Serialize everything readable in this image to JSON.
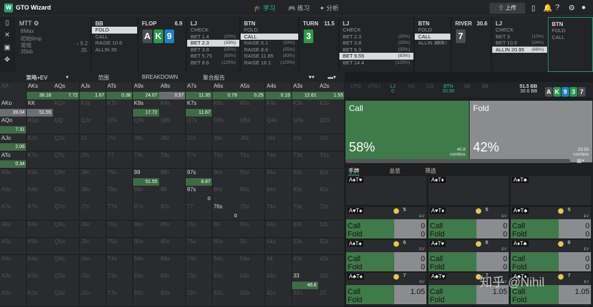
{
  "app": {
    "title": "GTO Wizard",
    "tabs": [
      "学习",
      "练习",
      "分析"
    ],
    "upload": "上传"
  },
  "mtt": {
    "title": "MTT",
    "lines": [
      "8Max",
      "初始limp",
      "常规",
      "35bb"
    ],
    "side": [
      "9.2",
      "35"
    ]
  },
  "colors": {
    "accent": "#1e9e6c",
    "call": "#3f7a4a",
    "fold": "#8a8c90"
  },
  "columns": [
    {
      "hd": "BB",
      "acts": [
        [
          "FOLD",
          ""
        ],
        [
          "CALL",
          ""
        ],
        [
          "RAISE 10.6",
          ""
        ],
        [
          "ALLIN 35",
          ""
        ]
      ],
      "sel": 0
    },
    {
      "hd": "FLOP",
      "sub": "6.9",
      "cards": [
        [
          "A",
          "s"
        ],
        [
          "K",
          "c"
        ],
        [
          "9",
          "d"
        ]
      ]
    },
    {
      "hd": "LJ",
      "acts": [
        [
          "CHECK",
          ""
        ],
        [
          "BET 1.4",
          "(20%)"
        ],
        [
          "BET 2.3",
          "(33%)"
        ],
        [
          "BET 3.8",
          "(55%)"
        ],
        [
          "BET 5.75",
          "(83%)"
        ],
        [
          "BET 8.6",
          "(125%)"
        ]
      ],
      "sel": 2
    },
    {
      "hd": "BTN",
      "acts": [
        [
          "FOLD",
          ""
        ],
        [
          "CALL",
          ""
        ],
        [
          "RAISE 6.1",
          "(33%)"
        ],
        [
          "RAISE 8.6",
          "(55%)"
        ],
        [
          "RAISE 11.85",
          "(83%)"
        ],
        [
          "RAISE 16.1",
          "(125%)"
        ]
      ],
      "sel": 1
    },
    {
      "hd": "TURN",
      "sub": "11.5",
      "cards": [
        [
          "3",
          "c"
        ]
      ]
    },
    {
      "hd": "LJ",
      "acts": [
        [
          "CHECK",
          ""
        ],
        [
          "BET 2.3",
          "(20%)"
        ],
        [
          "BET 3.8",
          "(33%)"
        ],
        [
          "BET 6.3",
          "(55%)"
        ],
        [
          "BET 9.55",
          "(83%)"
        ],
        [
          "BET 14.4",
          "(125%)"
        ]
      ],
      "sel": 4
    },
    {
      "hd": "BTN",
      "acts": [
        [
          "FOLD",
          ""
        ],
        [
          "CALL",
          ""
        ],
        [
          "ALLIN 30.5",
          "(66%)"
        ]
      ],
      "sel": 1
    },
    {
      "hd": "RIVER",
      "sub": "30.6",
      "cards": [
        [
          "7",
          "s"
        ]
      ]
    },
    {
      "hd": "LJ",
      "acts": [
        [
          "CHECK",
          ""
        ],
        [
          "BET 3",
          "(10%)"
        ],
        [
          "BET 10.5",
          "(34%)"
        ],
        [
          "ALLIN 20.95",
          "(68%)"
        ]
      ],
      "sel": 3
    },
    {
      "hd": "BTN",
      "acts": [
        [
          "FOLD",
          ""
        ],
        [
          "CALL",
          ""
        ]
      ],
      "sel": -1
    }
  ],
  "subtabs": [
    "策略+EV",
    "范围",
    "BREAKDOWN",
    "聚合报告"
  ],
  "grid": [
    [
      [
        "AA",
        "",
        ""
      ],
      [
        "AKs",
        "38.18",
        "g"
      ],
      [
        "AQs",
        "7.72",
        "g"
      ],
      [
        "AJs",
        "1.67",
        "g"
      ],
      [
        "ATs",
        "0.38",
        "g"
      ],
      [
        "A9s",
        "24.07",
        "g"
      ],
      [
        "A8s",
        "0.57",
        "gr"
      ],
      [
        "A7s",
        "11.35",
        "g"
      ],
      [
        "A6s",
        "0.79",
        "g"
      ],
      [
        "A5s",
        "0.25",
        "g"
      ],
      [
        "A4s",
        "0.19",
        "g"
      ],
      [
        "A3s",
        "12.61",
        "g"
      ],
      [
        "A2s",
        "1.55",
        "g"
      ]
    ],
    [
      [
        "AKo",
        "39.04",
        "gr"
      ],
      [
        "KK",
        "51.55",
        "gr"
      ],
      [
        "KQs",
        "",
        ""
      ],
      [
        "KJs",
        "",
        ""
      ],
      [
        "KTs",
        "",
        ""
      ],
      [
        "K9s",
        "17.72",
        "g"
      ],
      [
        "K8s",
        "",
        ""
      ],
      [
        "K7s",
        "11.67",
        "g"
      ],
      [
        "K6s",
        "",
        ""
      ],
      [
        "K5s",
        "",
        ""
      ],
      [
        "K4s",
        "",
        ""
      ],
      [
        "K3s",
        "",
        ""
      ],
      [
        "K2s",
        "",
        ""
      ]
    ],
    [
      [
        "AQo",
        "7.31",
        "g"
      ],
      [
        "KQo",
        "",
        ""
      ],
      [
        "QQ",
        "",
        ""
      ],
      [
        "QJs",
        "",
        ""
      ],
      [
        "QTs",
        "",
        ""
      ],
      [
        "Q9s",
        "",
        ""
      ],
      [
        "Q8s",
        "",
        ""
      ],
      [
        "Q7s",
        "",
        ""
      ],
      [
        "Q6s",
        "",
        ""
      ],
      [
        "Q5s",
        "",
        ""
      ],
      [
        "Q4s",
        "",
        ""
      ],
      [
        "Q3s",
        "",
        ""
      ],
      [
        "Q2s",
        "",
        ""
      ]
    ],
    [
      [
        "AJo",
        "2.06",
        "g"
      ],
      [
        "KJo",
        "",
        ""
      ],
      [
        "QJo",
        "",
        ""
      ],
      [
        "JJ",
        "",
        ""
      ],
      [
        "JTs",
        "",
        ""
      ],
      [
        "J9s",
        "",
        ""
      ],
      [
        "J8s",
        "",
        ""
      ],
      [
        "J7s",
        "",
        ""
      ],
      [
        "J6s",
        "",
        ""
      ],
      [
        "J5s",
        "",
        ""
      ],
      [
        "J4s",
        "",
        ""
      ],
      [
        "J3s",
        "",
        ""
      ],
      [
        "J2s",
        "",
        ""
      ]
    ],
    [
      [
        "ATo",
        "0.34",
        "g"
      ],
      [
        "KTo",
        "",
        ""
      ],
      [
        "QTo",
        "",
        ""
      ],
      [
        "JTo",
        "",
        ""
      ],
      [
        "TT",
        "",
        ""
      ],
      [
        "T9s",
        "",
        ""
      ],
      [
        "T8s",
        "",
        ""
      ],
      [
        "T7s",
        "",
        ""
      ],
      [
        "T6s",
        "",
        ""
      ],
      [
        "T5s",
        "",
        ""
      ],
      [
        "T4s",
        "",
        ""
      ],
      [
        "T3s",
        "",
        ""
      ],
      [
        "T2s",
        "",
        ""
      ]
    ],
    [
      [
        "A9o",
        "",
        ""
      ],
      [
        "K9o",
        "",
        ""
      ],
      [
        "Q9o",
        "",
        ""
      ],
      [
        "J9o",
        "",
        ""
      ],
      [
        "T9o",
        "",
        ""
      ],
      [
        "99",
        "51.55",
        "g"
      ],
      [
        "98s",
        "",
        ""
      ],
      [
        "97s",
        "8.87",
        "g"
      ],
      [
        "96s",
        "",
        ""
      ],
      [
        "95s",
        "",
        ""
      ],
      [
        "94s",
        "",
        ""
      ],
      [
        "93s",
        "",
        ""
      ],
      [
        "92s",
        "",
        ""
      ]
    ],
    [
      [
        "A8o",
        "",
        ""
      ],
      [
        "K8o",
        "",
        ""
      ],
      [
        "Q8o",
        "",
        ""
      ],
      [
        "J8o",
        "",
        ""
      ],
      [
        "T8o",
        "",
        ""
      ],
      [
        "98o",
        "",
        ""
      ],
      [
        "88",
        "",
        ""
      ],
      [
        "87s",
        "0",
        ""
      ],
      [
        "86s",
        "",
        ""
      ],
      [
        "85s",
        "",
        ""
      ],
      [
        "84s",
        "",
        ""
      ],
      [
        "83s",
        "",
        ""
      ],
      [
        "82s",
        "",
        ""
      ]
    ],
    [
      [
        "A7o",
        "",
        ""
      ],
      [
        "K7o",
        "",
        ""
      ],
      [
        "Q7o",
        "",
        ""
      ],
      [
        "J7o",
        "",
        ""
      ],
      [
        "T7o",
        "",
        ""
      ],
      [
        "97o",
        "",
        ""
      ],
      [
        "87o",
        "",
        ""
      ],
      [
        "77",
        "",
        ""
      ],
      [
        "76s",
        "0",
        ""
      ],
      [
        "75s",
        "",
        ""
      ],
      [
        "74s",
        "",
        ""
      ],
      [
        "73s",
        "",
        ""
      ],
      [
        "72s",
        "",
        ""
      ]
    ],
    [
      [
        "A6o",
        "",
        ""
      ],
      [
        "K6o",
        "",
        ""
      ],
      [
        "Q6o",
        "",
        ""
      ],
      [
        "J6o",
        "",
        ""
      ],
      [
        "T6o",
        "",
        ""
      ],
      [
        "96o",
        "",
        ""
      ],
      [
        "86o",
        "",
        ""
      ],
      [
        "76o",
        "",
        ""
      ],
      [
        "66",
        "",
        ""
      ],
      [
        "65s",
        "",
        ""
      ],
      [
        "64s",
        "",
        ""
      ],
      [
        "63s",
        "",
        ""
      ],
      [
        "62s",
        "",
        ""
      ]
    ],
    [
      [
        "A5o",
        "",
        ""
      ],
      [
        "K5o",
        "",
        ""
      ],
      [
        "Q5o",
        "",
        ""
      ],
      [
        "J5o",
        "",
        ""
      ],
      [
        "T5o",
        "",
        ""
      ],
      [
        "95o",
        "",
        ""
      ],
      [
        "85o",
        "",
        ""
      ],
      [
        "75o",
        "",
        ""
      ],
      [
        "65o",
        "",
        ""
      ],
      [
        "55",
        "",
        ""
      ],
      [
        "54s",
        "",
        ""
      ],
      [
        "53s",
        "",
        ""
      ],
      [
        "52s",
        "",
        ""
      ]
    ],
    [
      [
        "A4o",
        "",
        ""
      ],
      [
        "K4o",
        "",
        ""
      ],
      [
        "Q4o",
        "",
        ""
      ],
      [
        "J4o",
        "",
        ""
      ],
      [
        "T4o",
        "",
        ""
      ],
      [
        "94o",
        "",
        ""
      ],
      [
        "84o",
        "",
        ""
      ],
      [
        "74o",
        "",
        ""
      ],
      [
        "64o",
        "",
        ""
      ],
      [
        "54o",
        "",
        ""
      ],
      [
        "44",
        "",
        ""
      ],
      [
        "43s",
        "",
        ""
      ],
      [
        "42s",
        "",
        ""
      ]
    ],
    [
      [
        "A3o",
        "",
        ""
      ],
      [
        "K3o",
        "",
        ""
      ],
      [
        "Q3o",
        "",
        ""
      ],
      [
        "J3o",
        "",
        ""
      ],
      [
        "T3o",
        "",
        ""
      ],
      [
        "93o",
        "",
        ""
      ],
      [
        "83o",
        "",
        ""
      ],
      [
        "73o",
        "",
        ""
      ],
      [
        "63o",
        "",
        ""
      ],
      [
        "53o",
        "",
        ""
      ],
      [
        "43o",
        "",
        ""
      ],
      [
        "33",
        "46.6",
        "g"
      ],
      [
        "32s",
        "",
        ""
      ]
    ],
    [
      [
        "A2o",
        "",
        ""
      ],
      [
        "K2o",
        "",
        ""
      ],
      [
        "Q2o",
        "",
        ""
      ],
      [
        "J2o",
        "",
        ""
      ],
      [
        "T2o",
        "",
        ""
      ],
      [
        "92o",
        "",
        ""
      ],
      [
        "82o",
        "",
        ""
      ],
      [
        "72o",
        "",
        ""
      ],
      [
        "62o",
        "",
        ""
      ],
      [
        "52o",
        "",
        ""
      ],
      [
        "42o",
        "",
        ""
      ],
      [
        "32o",
        "",
        ""
      ],
      [
        "22",
        "",
        ""
      ]
    ]
  ],
  "seats": [
    "UTG",
    "UTG1",
    "LJ",
    "HJ",
    "CO",
    "BTN",
    "SB",
    "BB"
  ],
  "seat_sub": [
    "",
    "",
    "0",
    "",
    "",
    "20.95",
    "",
    ""
  ],
  "stack": {
    "top": "51.5 BB",
    "bot": "30.6 BB"
  },
  "board": [
    [
      "A",
      "s"
    ],
    [
      "K",
      "c"
    ],
    [
      "9",
      "d"
    ],
    [
      "3",
      "c"
    ],
    [
      "7",
      "s"
    ]
  ],
  "call": {
    "label": "Call",
    "pct": "58%",
    "combos": "40.8",
    "combos_label": "combos"
  },
  "fold": {
    "label": "Fold",
    "pct": "42%",
    "combos": "29.56",
    "combos_label": "combos"
  },
  "rtabs": [
    "手牌",
    "总览",
    "筛选"
  ],
  "combos_top": [
    "A♠T♥",
    "A♠T♦",
    "A♠T♣"
  ],
  "combos": [
    {
      "ch": "A♥T♠",
      "n": "5",
      "call": "0",
      "fold": "0"
    },
    {
      "ch": "A♥T♦",
      "n": "5",
      "call": "0",
      "fold": "0"
    },
    {
      "ch": "A♥T♣",
      "n": "5",
      "call": "0",
      "fold": "0"
    },
    {
      "ch": "A♦T♠",
      "n": "6",
      "call": "0",
      "fold": "0"
    },
    {
      "ch": "A♦T♥",
      "n": "6",
      "call": "0",
      "fold": "0"
    },
    {
      "ch": "A♦T♣",
      "n": "6",
      "call": "0",
      "fold": "0"
    },
    {
      "ch": "A♣T♠",
      "n": "7",
      "call": "1.05",
      "fold": ""
    },
    {
      "ch": "A♣T♥",
      "n": "7",
      "call": "1.05",
      "fold": ""
    },
    {
      "ch": "A♣T♦",
      "n": "7",
      "call": "1.05",
      "fold": ""
    }
  ],
  "labels": {
    "call": "Call",
    "fold": "Fold",
    "ev": "EV"
  },
  "watermark": "知乎 @Nihil"
}
